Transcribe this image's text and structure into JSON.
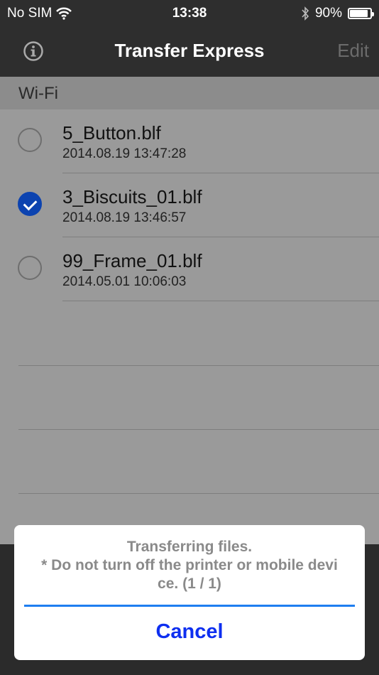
{
  "status_bar": {
    "carrier": "No SIM",
    "time": "13:38",
    "battery_percent": "90%",
    "battery_level": 0.9
  },
  "nav": {
    "title": "Transfer Express",
    "edit_label": "Edit",
    "info_icon": "info-icon"
  },
  "section": {
    "title": "Wi-Fi"
  },
  "files": [
    {
      "name": "5_Button.blf",
      "date": "2014.08.19 13:47:28",
      "selected": false
    },
    {
      "name": "3_Biscuits_01.blf",
      "date": "2014.08.19 13:46:57",
      "selected": true
    },
    {
      "name": "99_Frame_01.blf",
      "date": "2014.05.01 10:06:03",
      "selected": false
    }
  ],
  "dialog": {
    "line1": "Transferring files.",
    "line2": "* Do not turn off the printer or mobile devi",
    "line3": "ce. (1 / 1)",
    "progress": 1.0,
    "cancel_label": "Cancel"
  },
  "colors": {
    "accent": "#0e2ff0",
    "progress": "#1e7ef0",
    "checked": "#0c43b0"
  }
}
